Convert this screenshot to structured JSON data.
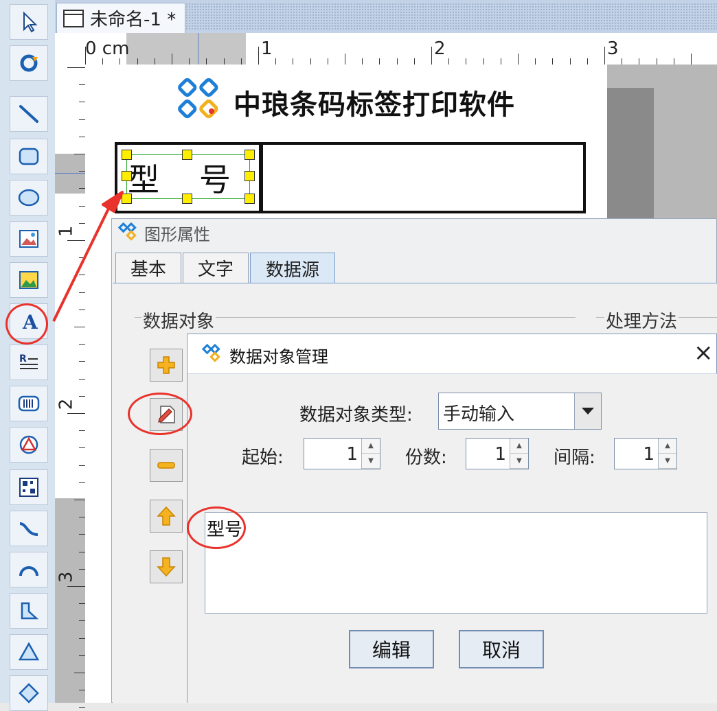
{
  "document_tab": {
    "title": "未命名-1 *"
  },
  "ruler": {
    "h_labels": [
      {
        "text": "0 cm"
      },
      {
        "text": "1"
      },
      {
        "text": "2"
      },
      {
        "text": "3"
      }
    ],
    "v_labels": [
      {
        "text": "1"
      },
      {
        "text": "2"
      },
      {
        "text": "3"
      }
    ]
  },
  "label_canvas": {
    "logo_text": "中琅条码标签打印软件",
    "selected_text": "型号"
  },
  "props_dialog": {
    "title": "图形属性",
    "tabs": [
      {
        "label": "基本"
      },
      {
        "label": "文字"
      },
      {
        "label": "数据源"
      }
    ],
    "data_object_group": "数据对象",
    "processing_group": "处理方法"
  },
  "data_object_dialog": {
    "title": "数据对象管理",
    "close": "×",
    "type_label": "数据对象类型:",
    "type_value": "手动输入",
    "start_label": "起始:",
    "start_value": "1",
    "copies_label": "份数:",
    "copies_value": "1",
    "interval_label": "间隔:",
    "interval_value": "1",
    "text_value": "型号",
    "edit_button": "编辑",
    "cancel_button": "取消"
  },
  "colors": {
    "annotation": "#e8322b",
    "accent": "#7a9cc8",
    "handle": "#ffee00"
  },
  "icons": [
    "pointer-icon",
    "rotate-icon",
    "line-icon",
    "rounded-rect-icon",
    "ellipse-icon",
    "image-icon",
    "picture-icon",
    "text-icon",
    "rtf-text-icon",
    "barcode-icon",
    "shape-icon",
    "qrcode-icon",
    "curve-icon",
    "arc-icon",
    "polygon-icon",
    "triangle-icon",
    "diamond-icon",
    "add-icon",
    "edit-icon",
    "remove-icon",
    "move-up-icon",
    "move-down-icon"
  ]
}
